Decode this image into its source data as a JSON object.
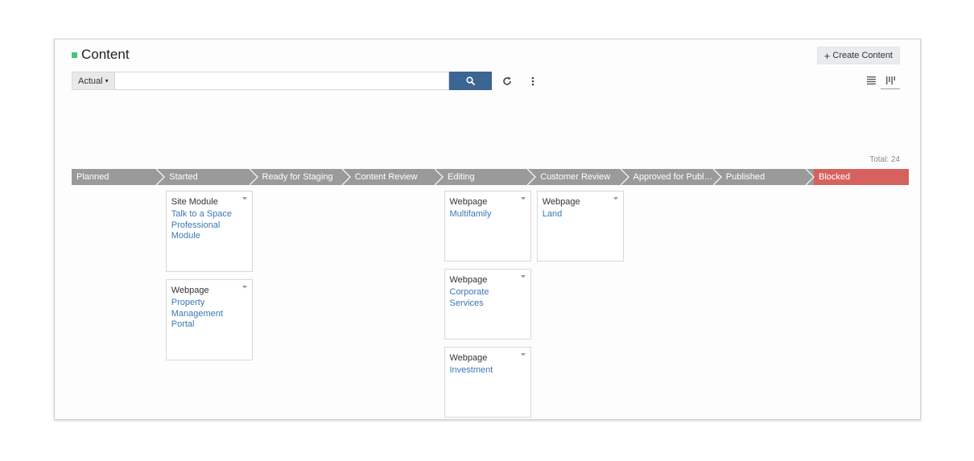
{
  "header": {
    "title": "Content",
    "create_label": "Create Content",
    "create_icon": "plus-icon",
    "accent": "#3ec97a"
  },
  "search": {
    "scope_label": "Actual",
    "value": "",
    "placeholder": "",
    "button_icon": "search-icon"
  },
  "toolbar": {
    "refresh_icon": "refresh-icon",
    "more_icon": "more-vertical-icon",
    "list_view_icon": "list-view-icon",
    "board_view_icon": "board-view-icon"
  },
  "board": {
    "total_label": "Total: 24",
    "stages": [
      {
        "label": "Planned"
      },
      {
        "label": "Started"
      },
      {
        "label": "Ready for Staging"
      },
      {
        "label": "Content Review"
      },
      {
        "label": "Editing"
      },
      {
        "label": "Customer Review"
      },
      {
        "label": "Approved for Publ…"
      },
      {
        "label": "Published"
      },
      {
        "label": "Blocked"
      }
    ],
    "cards": [
      {
        "stage": "Started",
        "type": "Site Module",
        "title": "Talk to a Space Professional Module"
      },
      {
        "stage": "Started",
        "type": "Webpage",
        "title": "Property Management Portal"
      },
      {
        "stage": "Editing",
        "type": "Webpage",
        "title": "Multifamily"
      },
      {
        "stage": "Editing",
        "type": "Webpage",
        "title": "Corporate Services"
      },
      {
        "stage": "Editing",
        "type": "Webpage",
        "title": "Investment"
      },
      {
        "stage": "Customer Review",
        "type": "Webpage",
        "title": "Land"
      }
    ],
    "colors": {
      "stage": "#9a9a9a",
      "blocked": "#d6625f",
      "link": "#3a78b5",
      "search_button": "#3b6593"
    }
  }
}
